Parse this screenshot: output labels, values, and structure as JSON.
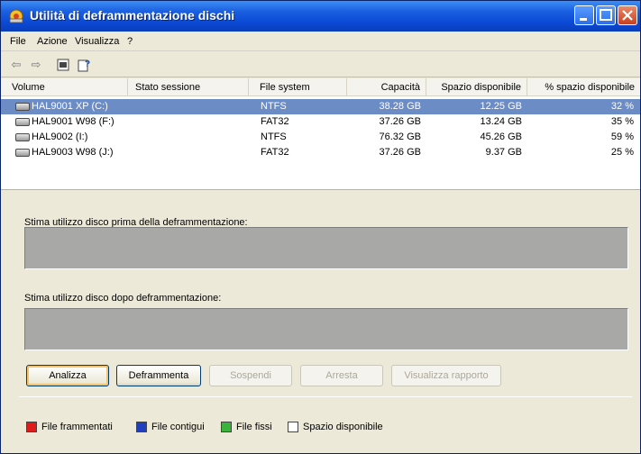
{
  "window": {
    "title": "Utilità di deframmentazione dischi"
  },
  "menu": {
    "items": [
      "File",
      "Azione",
      "Visualizza",
      "?"
    ]
  },
  "toolbar": {
    "icons": [
      "back-arrow-icon",
      "forward-arrow-icon",
      "properties-icon",
      "help-icon"
    ],
    "back_glyph": "⇦",
    "forward_glyph": "⇨"
  },
  "list": {
    "columns": [
      "Volume",
      "Stato sessione",
      "File system",
      "Capacità",
      "Spazio disponibile",
      "% spazio disponibile"
    ],
    "rows": [
      {
        "volume": "HAL9001 XP (C:)",
        "stato": "",
        "fs": "NTFS",
        "capacita": "38.28 GB",
        "spazio": "12.25 GB",
        "perc": "32 %",
        "selected": true
      },
      {
        "volume": "HAL9001 W98 (F:)",
        "stato": "",
        "fs": "FAT32",
        "capacita": "37.26 GB",
        "spazio": "13.24 GB",
        "perc": "35 %",
        "selected": false
      },
      {
        "volume": "HAL9002 (I:)",
        "stato": "",
        "fs": "NTFS",
        "capacita": "76.32 GB",
        "spazio": "45.26 GB",
        "perc": "59 %",
        "selected": false
      },
      {
        "volume": "HAL9003 W98 (J:)",
        "stato": "",
        "fs": "FAT32",
        "capacita": "37.26 GB",
        "spazio": "9.37 GB",
        "perc": "25 %",
        "selected": false
      }
    ]
  },
  "analysis": {
    "before_label": "Stima utilizzo disco prima della deframmentazione:",
    "after_label": "Stima utilizzo disco dopo deframmentazione:"
  },
  "buttons": {
    "analizza": "Analizza",
    "deframmenta": "Deframmenta",
    "sospendi": "Sospendi",
    "arresta": "Arresta",
    "rapporto": "Visualizza rapporto"
  },
  "legend": {
    "frammentati": {
      "label": "File frammentati",
      "color": "#e01b1b"
    },
    "contigui": {
      "label": "File contigui",
      "color": "#1f3fbf"
    },
    "fissi": {
      "label": "File fissi",
      "color": "#3cb43c"
    },
    "disponibile": {
      "label": "Spazio disponibile",
      "color": "#ffffff"
    }
  },
  "colors": {
    "title_bar": "#0b49d6",
    "selection": "#6c8cc6",
    "usage_bar": "#a8a8a6"
  }
}
